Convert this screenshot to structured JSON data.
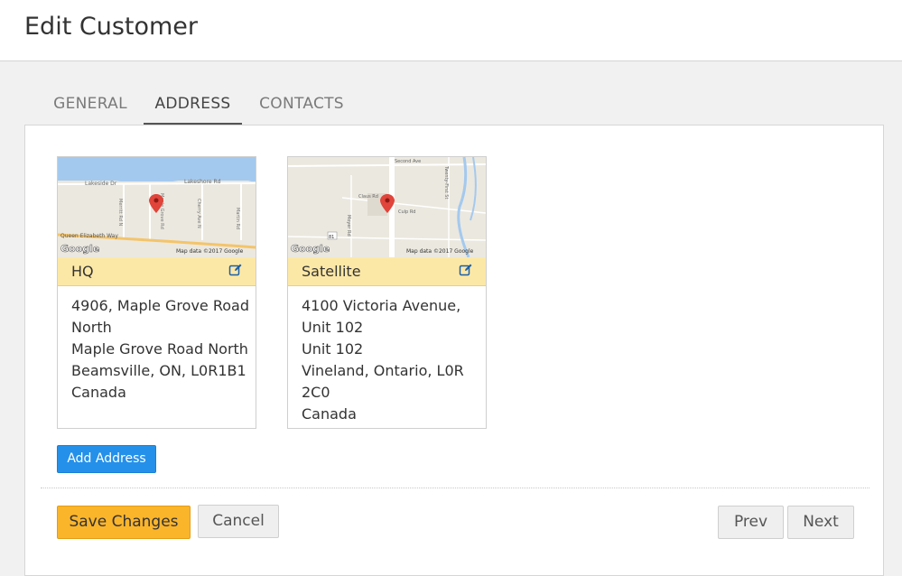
{
  "header": {
    "title": "Edit Customer"
  },
  "tabs": [
    {
      "label": "GENERAL",
      "active": false
    },
    {
      "label": "ADDRESS",
      "active": true
    },
    {
      "label": "CONTACTS",
      "active": false
    }
  ],
  "addresses": [
    {
      "name": "HQ",
      "lines": [
        "4906, Maple Grove Road",
        "North",
        "Maple Grove Road North",
        "Beamsville, ON, L0R1B1",
        "Canada"
      ],
      "map": {
        "brand": "Google",
        "attribution": "Map data ©2017 Google",
        "labels": [
          "Lakeside Dr",
          "Lakeshore Rd",
          "Merritt Rd N",
          "Maple Grove Rd",
          "Cherry Ave N",
          "Martin Rd",
          "Queen Elizabeth Way"
        ]
      }
    },
    {
      "name": "Satellite",
      "lines": [
        "4100 Victoria Avenue,",
        "Unit 102",
        "Unit 102",
        "Vineland, Ontario, L0R",
        "2C0",
        "Canada"
      ],
      "map": {
        "brand": "Google",
        "attribution": "Map data ©2017 Google",
        "labels": [
          "Second Ave",
          "Twenty-First St",
          "Claus Rd",
          "Culp Rd",
          "Moyer Rd",
          "81"
        ]
      }
    }
  ],
  "actions": {
    "add_address": "Add Address",
    "save": "Save Changes",
    "cancel": "Cancel",
    "prev": "Prev",
    "next": "Next"
  },
  "colors": {
    "accent_blue": "#2490ea",
    "save_orange": "#fbb52b",
    "card_header": "#fce8a6",
    "map_pin": "#e0443a"
  },
  "icons": {
    "edit": "edit-icon",
    "map_pin": "map-pin-icon"
  }
}
